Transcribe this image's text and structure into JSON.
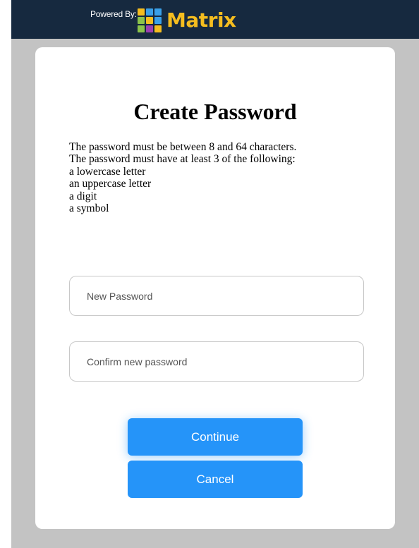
{
  "header": {
    "powered_by": "Powered By:",
    "brand_name": "Matrix",
    "logo_colors": [
      "#f5bd1f",
      "#3aa0e8",
      "#3aa0e8",
      "#8bc34a",
      "#f5bd1f",
      "#3aa0e8",
      "#8bc34a",
      "#9c3fb0",
      "#f5bd1f"
    ],
    "brand_color": "#f5bd1f",
    "background": "#16293f"
  },
  "form": {
    "title": "Create Password",
    "rules": [
      "The password must be between 8 and 64 characters.",
      "The password must have at least 3 of the following:",
      "a lowercase letter",
      "an uppercase letter",
      "a digit",
      "a symbol"
    ],
    "new_password": {
      "placeholder": "New Password",
      "value": ""
    },
    "confirm_password": {
      "placeholder": "Confirm new password",
      "value": ""
    },
    "continue_label": "Continue",
    "cancel_label": "Cancel",
    "button_color": "#2594f9"
  }
}
